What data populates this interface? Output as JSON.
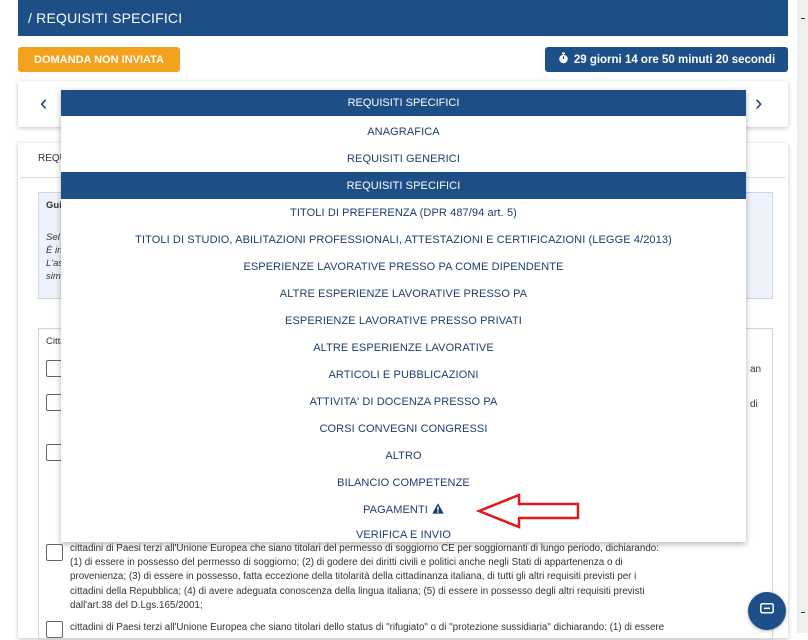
{
  "header": {
    "title": "/ REQUISITI SPECIFICI"
  },
  "status": {
    "label": "DOMANDA NON INVIATA"
  },
  "timer": {
    "label": "29 giorni 14 ore 50 minuti 20 secondi",
    "icon": "stopwatch-icon"
  },
  "nav": {
    "prev": "‹",
    "next": "›"
  },
  "dropdown": {
    "selected": "REQUISITI SPECIFICI",
    "options": [
      "ANAGRAFICA",
      "REQUISITI GENERICI",
      "REQUISITI SPECIFICI",
      "TITOLI DI PREFERENZA (DPR 487/94 art. 5)",
      "TITOLI DI STUDIO, ABILITAZIONI PROFESSIONALI, ATTESTAZIONI E CERTIFICAZIONI (LEGGE 4/2013)",
      "ESPERIENZE LAVORATIVE PRESSO PA COME DIPENDENTE",
      "ALTRE ESPERIENZE LAVORATIVE PRESSO PA",
      "ESPERIENZE LAVORATIVE PRESSO PRIVATI",
      "ALTRE ESPERIENZE LAVORATIVE",
      "ARTICOLI E PUBBLICAZIONI",
      "ATTIVITA' DI DOCENZA PRESSO PA",
      "CORSI CONVEGNI CONGRESSI",
      "ALTRO",
      "BILANCIO COMPETENZE",
      "PAGAMENTI",
      "VERIFICA E INVIO"
    ]
  },
  "background": {
    "card_title": "REQU",
    "guide_title": "Gui",
    "guide_lines": [
      "Sel",
      "È in",
      "L'as",
      "sim"
    ],
    "field_label": "Citta",
    "frag1": "an",
    "frag2": "di",
    "para1": [
      "cittadini di Paesi terzi all'Unione Europea che siano titolari del permesso di soggiorno CE per soggiornanti di lungo periodo, dichiarando:",
      "(1) di essere in possesso del permesso di soggiorno; (2) di godere dei diritti civili e politici anche negli Stati di appartenenza o di",
      "provenienza; (3) di essere in possesso, fatta eccezione della titolarità della cittadinanza italiana, di tutti gli altri requisiti previsti per i",
      "cittadini della Repubblica; (4) di avere adeguata conoscenza della lingua italiana; (5) di essere in possesso degli altri requisiti previsti",
      "dall'art.38 del D.Lgs.165/2001;"
    ],
    "para2": "cittadini di Paesi terzi all'Unione Europea che siano titolari dello status di \"rifugiato\" o di \"protezione sussidiaria\" dichiarando: (1) di essere"
  },
  "colors": {
    "primary": "#1d4f86",
    "warning": "#f4a21c",
    "arrow": "#e0191a"
  }
}
